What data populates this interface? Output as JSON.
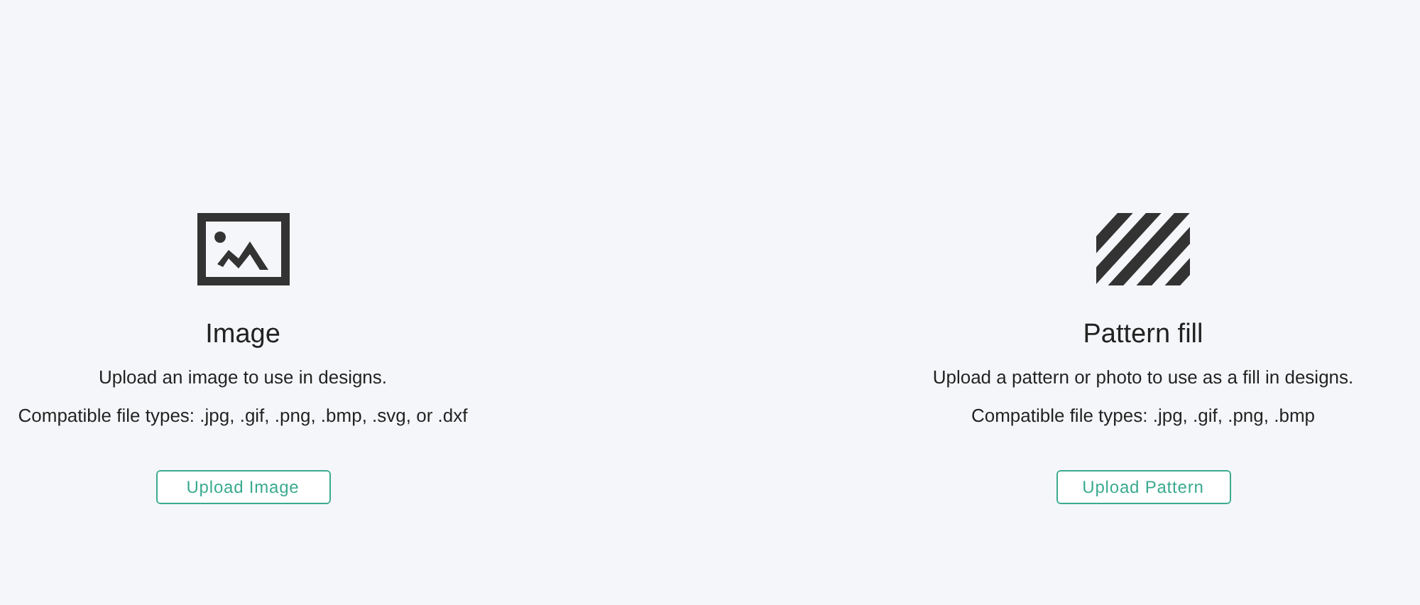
{
  "upload_options": [
    {
      "kind": "image",
      "title": "Image",
      "description": "Upload an image to use in designs.",
      "file_types": "Compatible file types: .jpg, .gif, .png, .bmp, .svg, or .dxf",
      "button": "Upload Image"
    },
    {
      "kind": "pattern",
      "title": "Pattern fill",
      "description": "Upload a pattern or photo to use as a fill in designs.",
      "file_types": "Compatible file types: .jpg, .gif, .png, .bmp",
      "button": "Upload Pattern"
    }
  ]
}
